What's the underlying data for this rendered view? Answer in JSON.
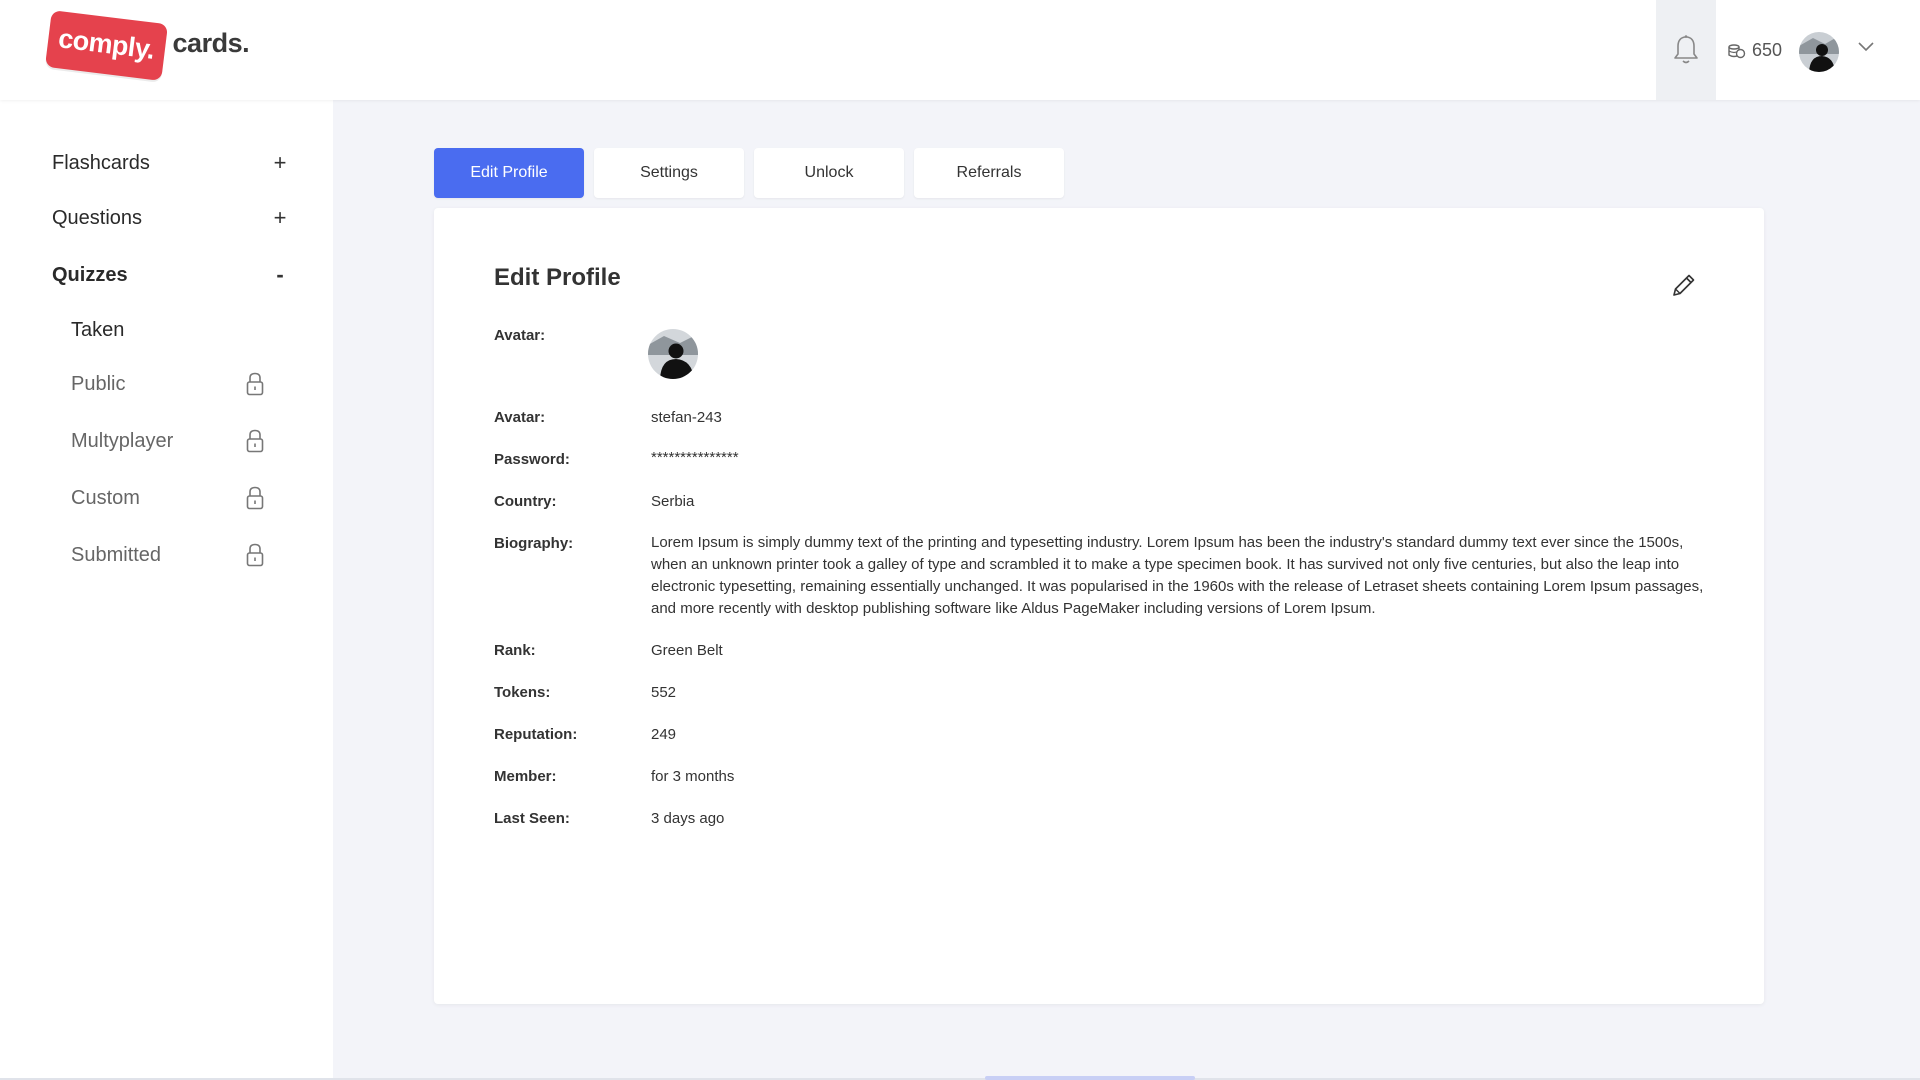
{
  "brand": {
    "logo_badge": "comply.",
    "logo_text": "cards."
  },
  "header": {
    "coins": "650",
    "accent": "#4a6cf0"
  },
  "sidebar": {
    "items": [
      {
        "label": "Flashcards",
        "toggle": "+"
      },
      {
        "label": "Questions",
        "toggle": "+"
      },
      {
        "label": "Quizzes",
        "toggle": "-"
      }
    ],
    "subitems": [
      {
        "label": "Taken",
        "locked": false
      },
      {
        "label": "Public",
        "locked": true
      },
      {
        "label": "Multyplayer",
        "locked": true
      },
      {
        "label": "Custom",
        "locked": true
      },
      {
        "label": "Submitted",
        "locked": true
      }
    ]
  },
  "tabs": [
    "Edit Profile",
    "Settings",
    "Unlock",
    "Referrals"
  ],
  "profile": {
    "title": "Edit Profile",
    "avatar_label": "Avatar:",
    "fields": [
      {
        "label": "Avatar:",
        "value": "stefan-243"
      },
      {
        "label": "Password:",
        "value": "***************"
      },
      {
        "label": "Country:",
        "value": "Serbia"
      },
      {
        "label": "Biography:",
        "value": "Lorem Ipsum is simply dummy text of the printing and typesetting industry. Lorem Ipsum has been the industry's standard dummy text ever since the 1500s, when an unknown printer took a galley of type and scrambled it to make a type specimen book. It has survived not only five centuries, but also the leap into electronic typesetting, remaining essentially unchanged. It was popularised in the 1960s with the release of Letraset sheets containing Lorem Ipsum passages, and more recently with desktop publishing software like Aldus PageMaker including versions of Lorem Ipsum."
      },
      {
        "label": "Rank:",
        "value": "Green Belt"
      },
      {
        "label": "Tokens:",
        "value": "552"
      },
      {
        "label": "Reputation:",
        "value": "249"
      },
      {
        "label": "Member:",
        "value": "for 3 months"
      },
      {
        "label": "Last Seen:",
        "value": "3 days ago"
      }
    ]
  }
}
